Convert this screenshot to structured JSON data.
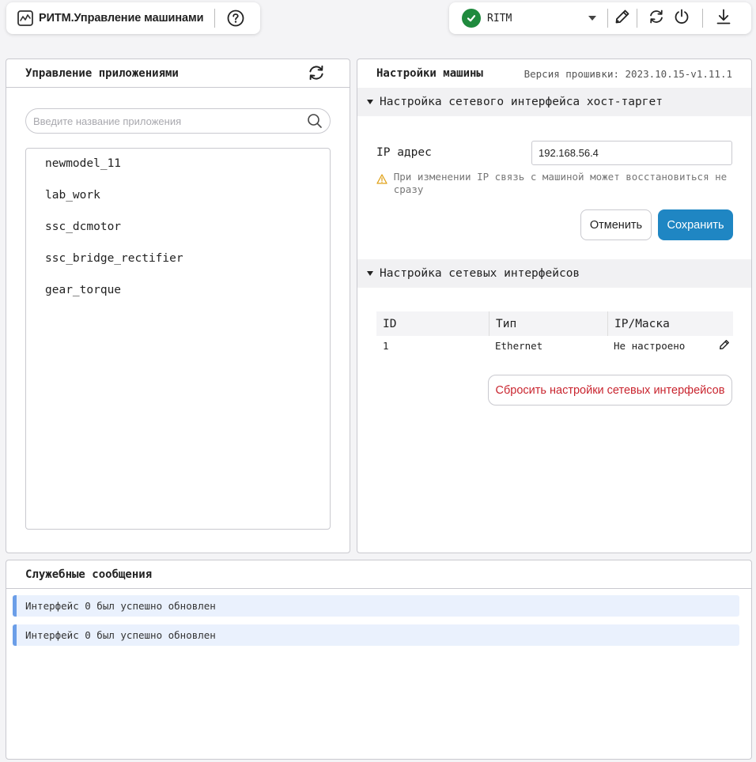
{
  "header": {
    "app_title": "РИТМ.Управление машинами",
    "machine_name": "RITM"
  },
  "apps_panel": {
    "title": "Управление приложениями",
    "search_placeholder": "Введите название приложения",
    "items": [
      "newmodel_11",
      "lab_work",
      "ssc_dcmotor",
      "ssc_bridge_rectifier",
      "gear_torque"
    ]
  },
  "machine_panel": {
    "title": "Настройки машины",
    "firmware": "Версия прошивки: 2023.10.15-v1.11.1",
    "host_section": {
      "title": "Настройка сетевого интерфейса хост-таргет",
      "ip_label": "IP адрес",
      "ip_value": "192.168.56.4",
      "warning": "При изменении IP связь с машиной может восстановиться не сразу",
      "cancel_label": "Отменить",
      "save_label": "Сохранить"
    },
    "net_section": {
      "title": "Настройка сетевых интерфейсов",
      "columns": [
        "ID",
        "Тип",
        "IP/Маска"
      ],
      "rows": [
        {
          "id": "1",
          "type": "Ethernet",
          "ip": "Не настроено"
        }
      ],
      "reset_label": "Сбросить настройки сетевых интерфейсов"
    }
  },
  "messages_panel": {
    "title": "Служебные сообщения",
    "items": [
      "Интерфейс 0 был успешно обновлен",
      "Интерфейс 0 был успешно обновлен"
    ]
  },
  "colors": {
    "status_ok": "#1f8a3d",
    "primary": "#1f86c3",
    "danger": "#c9252f",
    "message_bg": "#eaf1fd",
    "message_accent": "#6b9ee8"
  }
}
